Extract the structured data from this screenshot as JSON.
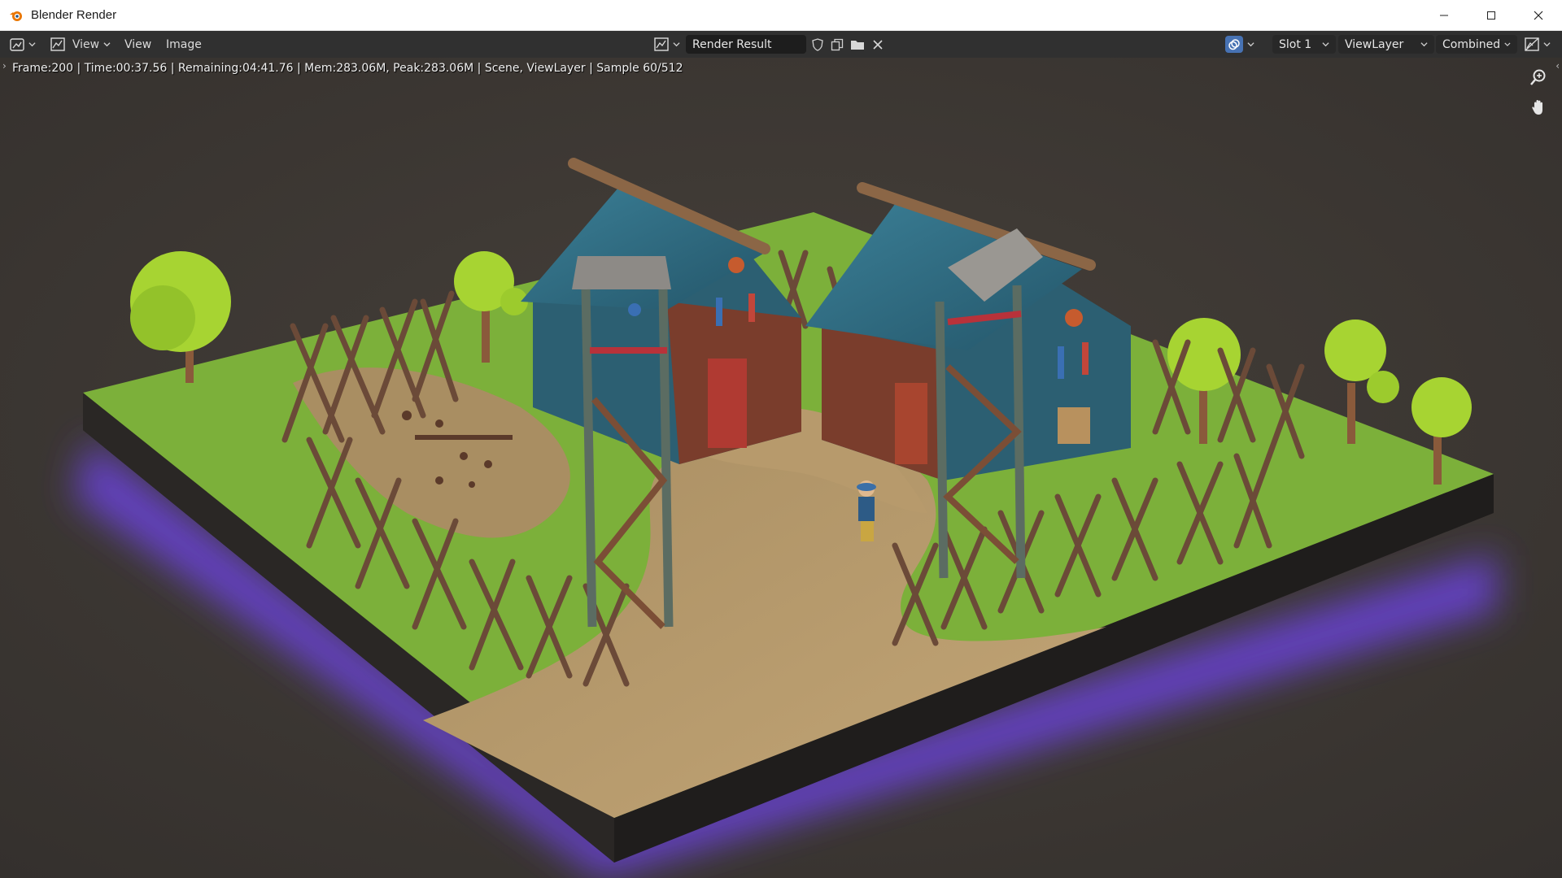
{
  "window": {
    "title": "Blender Render",
    "controls": [
      "minimize",
      "maximize",
      "close"
    ]
  },
  "header": {
    "editor_type_icon": "image-editor-icon",
    "view_mode_label": "View",
    "menus": [
      "View",
      "Image"
    ],
    "image_browse_icon": "image-browse-icon",
    "image_name": "Render Result",
    "fake_user_icon": "shield-icon",
    "new_image_icon": "duplicate-icon",
    "open_image_icon": "folder-icon",
    "unlink_icon": "close-icon",
    "overlay_icon": "overlay-icon",
    "slot": "Slot 1",
    "view_layer": "ViewLayer",
    "pass": "Combined",
    "display_channels_icon": "display-channels-icon"
  },
  "viewport": {
    "render_info": "Frame:200 | Time:00:37.56 | Remaining:04:41.76 | Mem:283.06M, Peak:283.06M | Scene, ViewLayer | Sample 60/512",
    "zoom_icon": "zoom-icon",
    "pan_icon": "hand-icon"
  },
  "colors": {
    "titlebar_bg": "#ffffff",
    "header_bg": "#303030",
    "viewport_bg": "#3a3633",
    "grass": "#7db13a",
    "dirt": "#b79a6c",
    "hut_roof": "#2f6d83",
    "glow": "#6a43d8"
  }
}
